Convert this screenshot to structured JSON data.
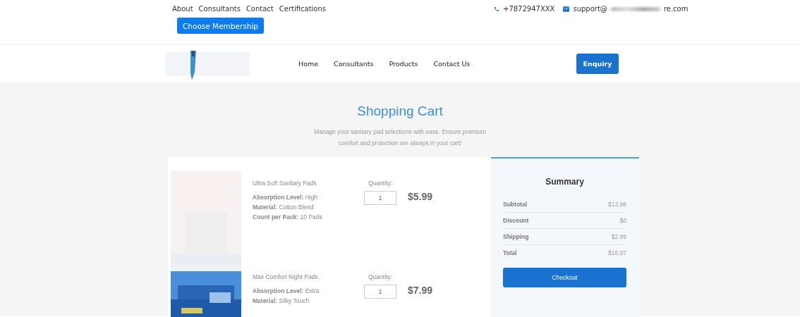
{
  "top_links": [
    "About",
    "Consultants",
    "Contact",
    "Certifications"
  ],
  "membership_button": "Choose Membership",
  "contact": {
    "phone": "+7872947XXX",
    "email_start": "support@",
    "email_end": "re.com"
  },
  "nav": {
    "links": [
      "Home",
      "Consultants",
      "Products",
      "Contact Us"
    ],
    "enquiry": "Enquiry"
  },
  "header": {
    "title": "Shopping Cart",
    "subtitle": "Manage your sanitary pad selections with ease. Ensure premium comfort and protection are always in your cart!"
  },
  "items": [
    {
      "name": "Ultra Soft Sanitary Pads",
      "quantity_label": "Quantity:",
      "quantity": "1",
      "price": "$5.99",
      "image": {
        "kind": "picture"
      },
      "specs": [
        {
          "label": "Absorption Level:",
          "value": "High"
        },
        {
          "label": "Material:",
          "value": "Cotton Blend"
        },
        {
          "label": "Count per Pack:",
          "value": "10 Pads"
        }
      ]
    },
    {
      "name": "Max Comfort Night Pads",
      "quantity_label": "Quantity:",
      "quantity": "1",
      "price": "$7.99",
      "image": {
        "kind": "picture"
      },
      "specs": [
        {
          "label": "Absorption Level:",
          "value": "Extra"
        },
        {
          "label": "Material:",
          "value": "Silky Touch"
        }
      ]
    }
  ],
  "summary": {
    "title": "Summary",
    "rows": [
      {
        "label": "Subtotal",
        "value": "$13.98"
      },
      {
        "label": "Discount",
        "value": "$0"
      },
      {
        "label": "Shipping",
        "value": "$2.99"
      },
      {
        "label": "Total",
        "value": "$16.97"
      }
    ],
    "checkout": "Checkout"
  }
}
